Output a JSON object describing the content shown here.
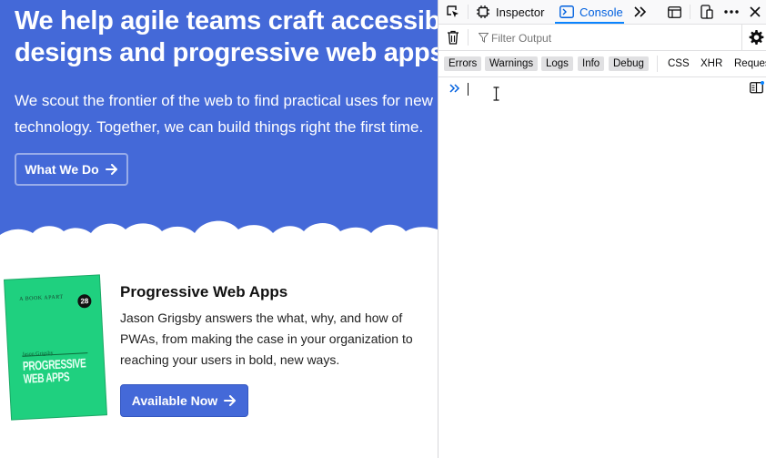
{
  "hero": {
    "title_line1": "We help agile teams craft accessible",
    "title_line2": "designs and progressive web apps!",
    "subtitle": "We scout the frontier of the web to find practical uses for new technology. Together, we can build things right the first time.",
    "cta_label": "What We Do"
  },
  "feature": {
    "book": {
      "publisher": "A BOOK APART",
      "number": "28",
      "author": "Jason Grigsby",
      "title": "PROGRESSIVE WEB APPS"
    },
    "title": "Progressive Web Apps",
    "description": "Jason Grigsby answers the what, why, and how of PWAs, from making the case in your organization to reaching your users in bold, new ways.",
    "cta_label": "Available Now"
  },
  "devtools": {
    "tabs": {
      "inspector": "Inspector",
      "console": "Console"
    },
    "active_tab": "Console",
    "filter": {
      "placeholder": "Filter Output",
      "value": ""
    },
    "levels": [
      "Errors",
      "Warnings",
      "Logs",
      "Info",
      "Debug"
    ],
    "categories": [
      "CSS",
      "XHR",
      "Reques"
    ],
    "colors": {
      "accent": "#0a84ff",
      "active_tab_text": "#0060df",
      "hero_bg": "#4469d8",
      "book_cover": "#1fd07f"
    },
    "icons": [
      "pick-element-icon",
      "inspector-icon",
      "console-icon",
      "more-tools-chevron-icon",
      "dock-icon",
      "responsive-design-icon",
      "more-options-icon",
      "close-icon",
      "trash-icon",
      "filter-icon",
      "settings-gear-icon",
      "prompt-chevron-icon",
      "split-console-icon"
    ]
  }
}
